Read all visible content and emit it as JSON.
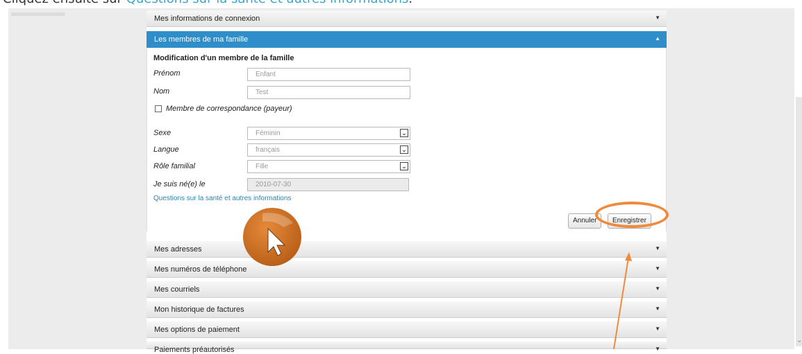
{
  "instruction": {
    "prefix": "Cliquez ensuite sur ",
    "link": "Questions sur la santé et autres informations",
    "suffix": "."
  },
  "sections_top": [
    {
      "label": "Mes informations de connexion",
      "arrow": "▼"
    },
    {
      "label": "Les membres de ma famille",
      "arrow": "▲"
    }
  ],
  "form": {
    "title": "Modification d'un membre de la famille",
    "first_name": {
      "label": "Prénom",
      "value": "Enfant"
    },
    "last_name": {
      "label": "Nom",
      "value": "Test"
    },
    "checkbox_label": "Membre de correspondance (payeur)",
    "sex": {
      "label": "Sexe",
      "value": "Féminin"
    },
    "language": {
      "label": "Langue",
      "value": "français"
    },
    "role": {
      "label": "Rôle familial",
      "value": "Fille"
    },
    "birthdate": {
      "label": "Je suis né(e) le",
      "value": "2010-07-30"
    },
    "health_link": "Questions sur la santé et autres informations",
    "cancel": "Annuler",
    "save": "Enregistrer"
  },
  "sections_bottom": [
    {
      "label": "Mes adresses",
      "arrow": "▼"
    },
    {
      "label": "Mes numéros de téléphone",
      "arrow": "▼"
    },
    {
      "label": "Mes courriels",
      "arrow": "▼"
    },
    {
      "label": "Mon historique de factures",
      "arrow": "▼"
    },
    {
      "label": "Mes options de paiement",
      "arrow": "▼"
    },
    {
      "label": "Paiements préautorisés",
      "arrow": "▼"
    }
  ],
  "colors": {
    "accent": "#2f8ec9",
    "highlight": "#f08a3a",
    "link": "#2a83b6"
  }
}
